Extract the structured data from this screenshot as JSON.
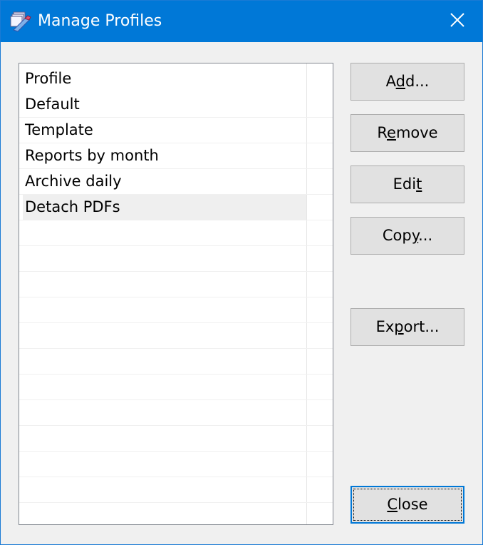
{
  "window": {
    "title": "Manage Profiles"
  },
  "list": {
    "column_header": "Profile",
    "items": [
      {
        "label": "Default",
        "selected": false
      },
      {
        "label": "Template",
        "selected": false
      },
      {
        "label": "Reports by month",
        "selected": false
      },
      {
        "label": "Archive daily",
        "selected": false
      },
      {
        "label": "Detach PDFs",
        "selected": true
      }
    ]
  },
  "buttons": {
    "add": {
      "pre": "A",
      "mnemonic": "d",
      "post": "d..."
    },
    "remove": {
      "pre": "R",
      "mnemonic": "e",
      "post": "move"
    },
    "edit": {
      "pre": "Edi",
      "mnemonic": "t",
      "post": ""
    },
    "copy": {
      "pre": "Cop",
      "mnemonic": "y",
      "post": "..."
    },
    "export": {
      "pre": "Ex",
      "mnemonic": "p",
      "post": "ort..."
    },
    "close": {
      "pre": "",
      "mnemonic": "C",
      "post": "lose"
    }
  },
  "colors": {
    "titlebar": "#0078d7",
    "accent": "#0078d7",
    "selection": "#efefef"
  }
}
